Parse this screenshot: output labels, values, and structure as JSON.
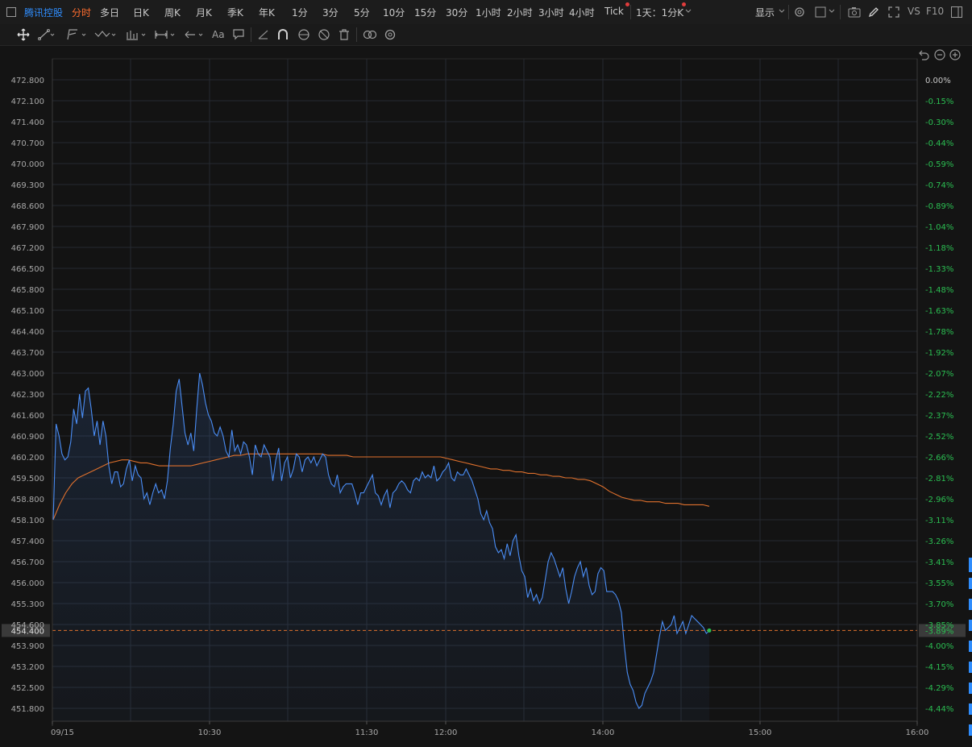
{
  "topbar": {
    "symbol": "腾讯控股",
    "timeframes": [
      "分时",
      "多日",
      "日K",
      "周K",
      "月K",
      "季K",
      "年K",
      "1分",
      "3分",
      "5分",
      "10分",
      "15分",
      "30分",
      "1小时",
      "2小时",
      "3小时",
      "4小时",
      "Tick"
    ],
    "active_timeframe": "分时",
    "period_select": "1天：1分K",
    "display_label": "显示",
    "vs_label": "VS",
    "f10_label": "F10"
  },
  "toolbar": {
    "text_tool_label": "Aa",
    "icons": [
      "move-icon",
      "line-tool-icon",
      "channel-tool-icon",
      "wave-tool-icon",
      "pattern-tool-icon",
      "measure-tool-icon",
      "arrow-tool-icon",
      "text-tool-icon",
      "comment-icon",
      "angle-icon",
      "magnet-icon",
      "lock-icon",
      "hide-icon",
      "trash-icon",
      "link-icon",
      "settings-icon"
    ]
  },
  "chart_controls": {
    "icons": [
      "undo-icon",
      "zoom-out-icon",
      "zoom-in-icon"
    ]
  },
  "colors": {
    "price_line": "#4a8df5",
    "avg_line": "#e0712d",
    "positive_text": "#2bbf52",
    "grid": "#262a30",
    "last_price_line": "#e0712d"
  },
  "chart_data": {
    "type": "line",
    "title": "",
    "y_left_ticks": [
      "472.800",
      "472.100",
      "471.400",
      "470.700",
      "470.000",
      "469.300",
      "468.600",
      "467.900",
      "467.200",
      "466.500",
      "465.800",
      "465.100",
      "464.400",
      "463.700",
      "463.000",
      "462.300",
      "461.600",
      "460.900",
      "460.200",
      "459.500",
      "458.800",
      "458.100",
      "457.400",
      "456.700",
      "456.000",
      "455.300",
      "454.600",
      "453.900",
      "453.200",
      "452.500",
      "451.800"
    ],
    "y_right_ticks": [
      "0.00%",
      "-0.15%",
      "-0.30%",
      "-0.44%",
      "-0.59%",
      "-0.74%",
      "-0.89%",
      "-1.04%",
      "-1.18%",
      "-1.33%",
      "-1.48%",
      "-1.63%",
      "-1.78%",
      "-1.92%",
      "-2.07%",
      "-2.22%",
      "-2.37%",
      "-2.52%",
      "-2.66%",
      "-2.81%",
      "-2.96%",
      "-3.11%",
      "-3.26%",
      "-3.41%",
      "-3.55%",
      "-3.70%",
      "-3.85%",
      "-4.00%",
      "-4.15%",
      "-4.29%",
      "-4.44%"
    ],
    "x_ticks": [
      "09/15",
      "10:30",
      "11:30",
      "12:00",
      "14:00",
      "15:00",
      "16:00"
    ],
    "ylim": [
      451.8,
      472.8
    ],
    "last_price_label": "454.400",
    "last_change_label": "-3.89%",
    "last_price": 454.4,
    "series": [
      {
        "name": "",
        "role": "price",
        "values": [
          458.1,
          461.3,
          460.9,
          460.3,
          460.1,
          460.2,
          460.7,
          461.8,
          461.3,
          462.3,
          461.5,
          462.4,
          462.5,
          461.8,
          460.9,
          461.4,
          460.6,
          461.4,
          460.9,
          459.9,
          459.3,
          459.7,
          459.7,
          459.2,
          459.3,
          459.8,
          460.1,
          459.4,
          459.9,
          459.6,
          459.5,
          458.8,
          459.0,
          458.6,
          459.0,
          459.3,
          459.0,
          459.1,
          458.8,
          459.4,
          460.5,
          461.3,
          462.4,
          462.8,
          461.9,
          461.0,
          460.6,
          461.0,
          460.4,
          461.8,
          463.0,
          462.6,
          462.0,
          461.6,
          461.4,
          461.0,
          460.9,
          461.2,
          460.9,
          460.4,
          460.2,
          461.1,
          460.4,
          460.6,
          460.3,
          460.7,
          460.6,
          460.2,
          459.6,
          460.6,
          460.3,
          460.2,
          460.6,
          460.4,
          460.2,
          459.4,
          460.1,
          460.5,
          459.4,
          460.0,
          460.2,
          459.5,
          459.8,
          460.3,
          460.2,
          459.7,
          460.1,
          460.2,
          460.0,
          460.2,
          459.9,
          460.1,
          460.3,
          460.2,
          459.6,
          459.3,
          459.2,
          459.6,
          459.0,
          459.2,
          459.3,
          459.3,
          459.3,
          459.0,
          458.6,
          459.0,
          459.0,
          459.2,
          459.4,
          459.6,
          459.0,
          458.9,
          458.6,
          458.9,
          459.1,
          458.5,
          459.0,
          459.1,
          459.3,
          459.4,
          459.3,
          459.1,
          459.0,
          459.4,
          459.5,
          459.4,
          459.7,
          459.5,
          459.6,
          459.5,
          459.9,
          459.4,
          459.5,
          459.7,
          459.8,
          460.0,
          459.5,
          459.4,
          459.7,
          459.6,
          459.6,
          459.8,
          459.6,
          459.4,
          459.1,
          458.8,
          458.3,
          458.1,
          458.4,
          458.0,
          457.8,
          457.2,
          457.0,
          457.1,
          456.8,
          457.3,
          456.9,
          457.4,
          457.6,
          456.9,
          456.4,
          456.2,
          455.5,
          455.8,
          455.4,
          455.6,
          455.3,
          455.5,
          456.1,
          456.7,
          457.0,
          456.8,
          456.5,
          456.2,
          456.5,
          455.8,
          455.3,
          455.7,
          456.2,
          456.5,
          456.7,
          456.2,
          456.5,
          455.9,
          455.6,
          455.7,
          456.3,
          456.5,
          456.4,
          455.7,
          455.7,
          455.7,
          455.6,
          455.4,
          455.0,
          453.9,
          453.0,
          452.6,
          452.4,
          452.0,
          451.8,
          451.9,
          452.3,
          452.5,
          452.7,
          453.0,
          453.6,
          454.2,
          454.7,
          454.4,
          454.5,
          454.6,
          454.9,
          454.3,
          454.5,
          454.7,
          454.3,
          454.6,
          454.9,
          454.8,
          454.7,
          454.6,
          454.5,
          454.3,
          454.4
        ]
      },
      {
        "name": "",
        "role": "average",
        "values": [
          458.1,
          458.6,
          459.0,
          459.3,
          459.5,
          459.6,
          459.7,
          459.8,
          459.9,
          460.0,
          460.05,
          460.1,
          460.1,
          460.05,
          460.0,
          460.0,
          459.95,
          459.9,
          459.9,
          459.9,
          459.9,
          459.9,
          459.9,
          459.95,
          460.0,
          460.05,
          460.1,
          460.15,
          460.2,
          460.25,
          460.25,
          460.3,
          460.3,
          460.3,
          460.3,
          460.3,
          460.3,
          460.3,
          460.3,
          460.3,
          460.3,
          460.3,
          460.3,
          460.3,
          460.25,
          460.25,
          460.25,
          460.25,
          460.2,
          460.2,
          460.2,
          460.2,
          460.2,
          460.2,
          460.2,
          460.2,
          460.2,
          460.2,
          460.2,
          460.2,
          460.2,
          460.2,
          460.2,
          460.15,
          460.1,
          460.05,
          460.0,
          459.95,
          459.9,
          459.85,
          459.8,
          459.8,
          459.75,
          459.75,
          459.7,
          459.7,
          459.65,
          459.65,
          459.6,
          459.6,
          459.55,
          459.55,
          459.5,
          459.5,
          459.45,
          459.45,
          459.4,
          459.3,
          459.2,
          459.05,
          458.95,
          458.85,
          458.8,
          458.75,
          458.75,
          458.7,
          458.7,
          458.7,
          458.65,
          458.65,
          458.65,
          458.6,
          458.6,
          458.6,
          458.6,
          458.55
        ]
      }
    ]
  }
}
